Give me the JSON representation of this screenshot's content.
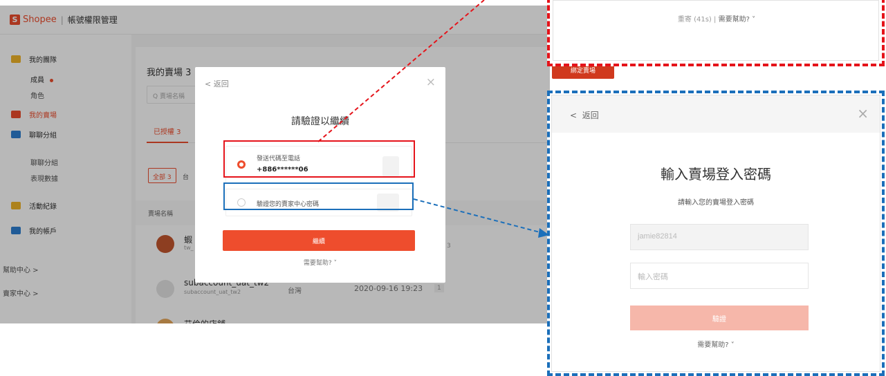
{
  "app": {
    "brand": "Shopee",
    "separator": "|",
    "title": "帳號權限管理"
  },
  "sidebar": {
    "my_team": "我的團隊",
    "members": "成員",
    "roles": "角色",
    "my_shop": "我的賣場",
    "chat_group_header": "聊聊分組",
    "chat_group": "聊聊分組",
    "performance": "表現數據",
    "activity_log": "活動紀錄",
    "my_account": "我的帳戶",
    "help_center": "幫助中心 >",
    "seller_center": "賣家中心 >"
  },
  "main": {
    "title": "我的賣場 3",
    "search_placeholder": "Q 賣場名稱",
    "tab_authorized": "已授權 3",
    "filter_all": "全部 3",
    "filter_next": "台",
    "column_shop_name": "賣場名稱",
    "bind_button": "綁定賣場",
    "rows": [
      {
        "name": "蝦",
        "sub": "tw_",
        "region": "",
        "date": "",
        "count": "3"
      },
      {
        "name": "subaccount_uat_tw2",
        "sub": "subaccount_uat_tw2",
        "region": "台灣",
        "date": "2020-09-16 19:23",
        "count": "1"
      },
      {
        "name": "艾倫的店鋪",
        "sub": "",
        "region": "",
        "date": "",
        "count": ""
      }
    ]
  },
  "modal": {
    "back": "< 返回",
    "close": "×",
    "title": "請驗證以繼續",
    "option_sms_label": "發送代碼至電話",
    "option_sms_phone": "+886******06",
    "option_password_label": "驗證您的賣家中心密碼",
    "continue_button": "繼續",
    "help": "需要幫助? ˅"
  },
  "panel_sms": {
    "resend": "重寄 (41s)",
    "separator": "|",
    "help": "需要幫助? ˅"
  },
  "panel_password": {
    "back": "返回",
    "close": "×",
    "title": "輸入賣場登入密碼",
    "subtitle": "請輸入您的賣場登入密碼",
    "username_value": "jamie82814",
    "password_placeholder": "輸入密碼",
    "verify_button": "驗證",
    "help": "需要幫助? ˅"
  },
  "colors": {
    "brand": "#ee4d2d",
    "highlight_red": "#e5131a",
    "highlight_blue": "#1b6fba"
  }
}
